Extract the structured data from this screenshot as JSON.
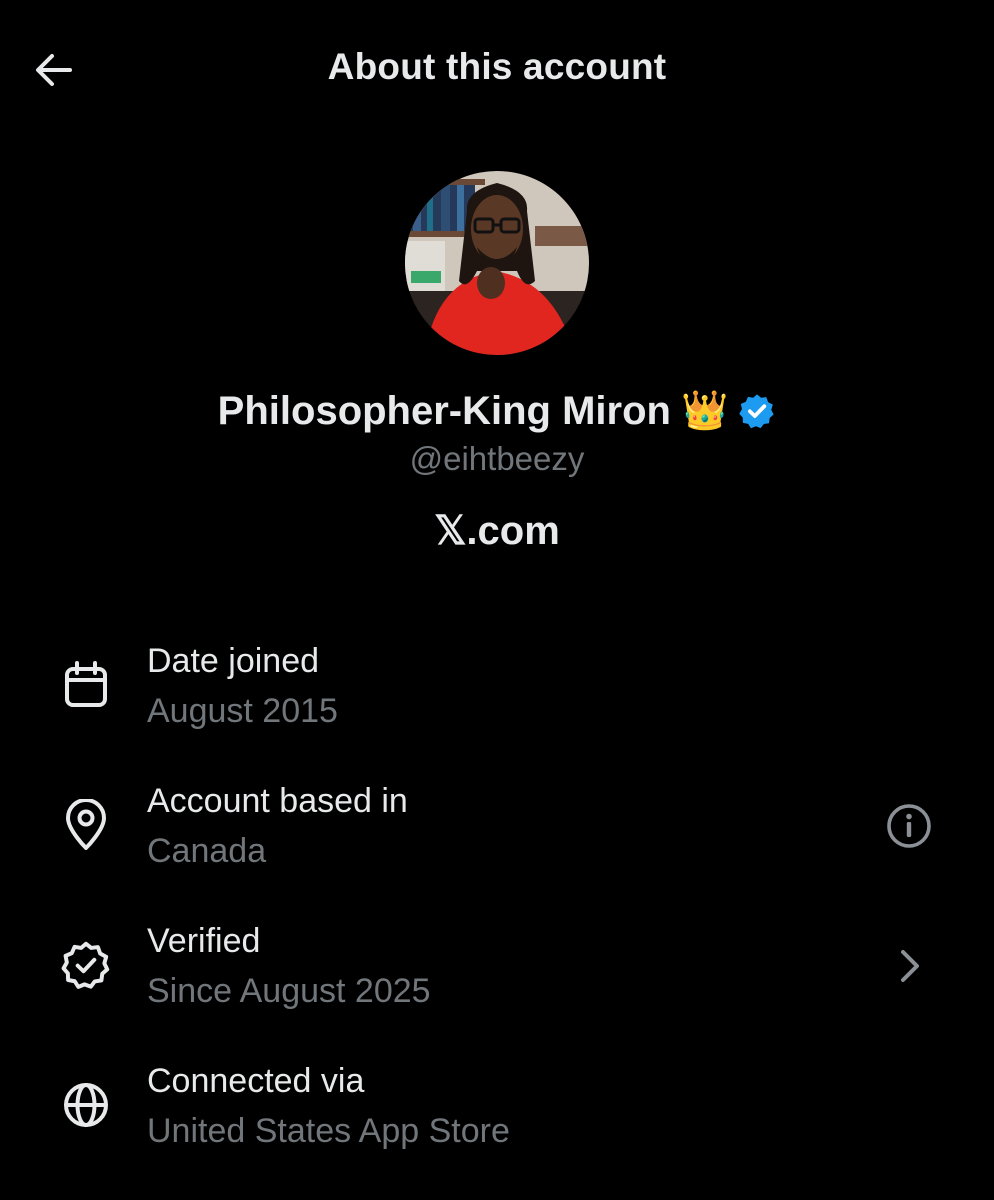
{
  "header": {
    "title": "About this account",
    "back_icon": "arrow-left-icon"
  },
  "profile": {
    "display_name": "Philosopher-King Miron",
    "emoji": "👑",
    "verified_badge_color": "#1d9bf0",
    "handle": "@eihtbeezy",
    "site": "𝕏.com"
  },
  "rows": [
    {
      "icon": "calendar-icon",
      "label": "Date joined",
      "value": "August 2015"
    },
    {
      "icon": "location-pin-icon",
      "label": "Account based in",
      "value": "Canada",
      "trailing_icon": "info-icon"
    },
    {
      "icon": "verified-badge-icon",
      "label": "Verified",
      "value": "Since August 2025",
      "trailing_icon": "chevron-right-icon"
    },
    {
      "icon": "globe-icon",
      "label": "Connected via",
      "value": "United States App Store"
    }
  ],
  "colors": {
    "background": "#000000",
    "primary_text": "#e7e9ea",
    "secondary_text": "#71767b",
    "accent": "#1d9bf0"
  }
}
